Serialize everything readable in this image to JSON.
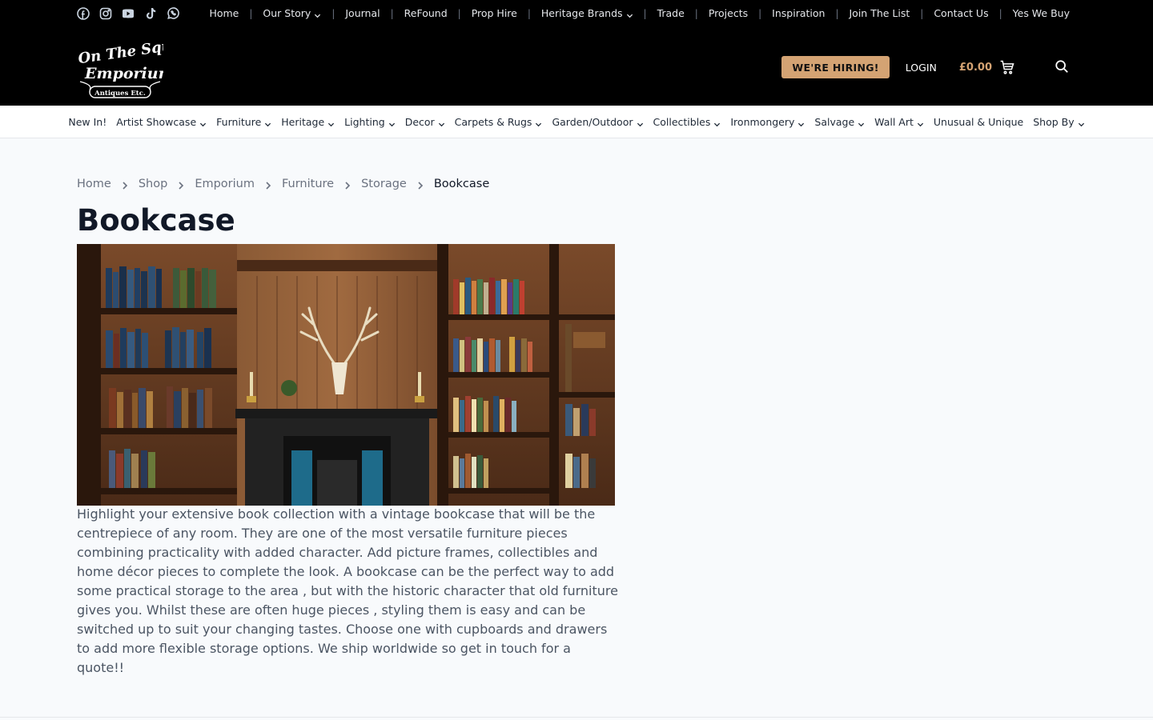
{
  "topnav": {
    "items": [
      {
        "label": "Home",
        "dropdown": false
      },
      {
        "label": "Our Story",
        "dropdown": true
      },
      {
        "label": "Journal",
        "dropdown": false
      },
      {
        "label": "ReFound",
        "dropdown": false
      },
      {
        "label": "Prop Hire",
        "dropdown": false
      },
      {
        "label": "Heritage Brands",
        "dropdown": true
      },
      {
        "label": "Trade",
        "dropdown": false
      },
      {
        "label": "Projects",
        "dropdown": false
      },
      {
        "label": "Inspiration",
        "dropdown": false
      },
      {
        "label": "Join The List",
        "dropdown": false
      },
      {
        "label": "Contact Us",
        "dropdown": false
      },
      {
        "label": "Yes We Buy",
        "dropdown": false
      }
    ],
    "separator": "|"
  },
  "social": [
    "facebook-icon",
    "instagram-icon",
    "youtube-icon",
    "tiktok-icon",
    "whatsapp-icon"
  ],
  "logo": {
    "line1": "On The Square",
    "line2": "Emporium",
    "line3": "Antiques Etc."
  },
  "header": {
    "hiring_label": "WE'RE HIRING!",
    "login_label": "LOGIN",
    "cart_total": "£0.00"
  },
  "catnav": [
    {
      "label": "New In!",
      "dropdown": false
    },
    {
      "label": "Artist Showcase",
      "dropdown": true
    },
    {
      "label": "Furniture",
      "dropdown": true
    },
    {
      "label": "Heritage",
      "dropdown": true
    },
    {
      "label": "Lighting",
      "dropdown": true
    },
    {
      "label": "Decor",
      "dropdown": true
    },
    {
      "label": "Carpets & Rugs",
      "dropdown": true
    },
    {
      "label": "Garden/Outdoor",
      "dropdown": true
    },
    {
      "label": "Collectibles",
      "dropdown": true
    },
    {
      "label": "Ironmongery",
      "dropdown": true
    },
    {
      "label": "Salvage",
      "dropdown": true
    },
    {
      "label": "Wall Art",
      "dropdown": true
    },
    {
      "label": "Unusual & Unique",
      "dropdown": false
    },
    {
      "label": "Shop By",
      "dropdown": true
    }
  ],
  "breadcrumb": [
    "Home",
    "Shop",
    "Emporium",
    "Furniture",
    "Storage",
    "Bookcase"
  ],
  "page": {
    "title": "Bookcase",
    "description": "Highlight your extensive book collection with a vintage bookcase that will be the centrepiece of any room. They are one of the most versatile furniture pieces combining practicality with added character. Add picture frames, collectibles and home décor pieces to complete the look. A bookcase can be the perfect way to add some practical storage to the area , but with the historic character that old furniture gives you. Whilst these are often huge pieces , styling them is easy and can be switched up to suit your changing tastes. Choose one with cupboards and drawers to add more flexible storage options. We ship worldwide so get in touch for a quote!!"
  },
  "colors": {
    "accent": "#d4a373",
    "header_bg": "#000000",
    "page_bg": "#f8fafc"
  }
}
